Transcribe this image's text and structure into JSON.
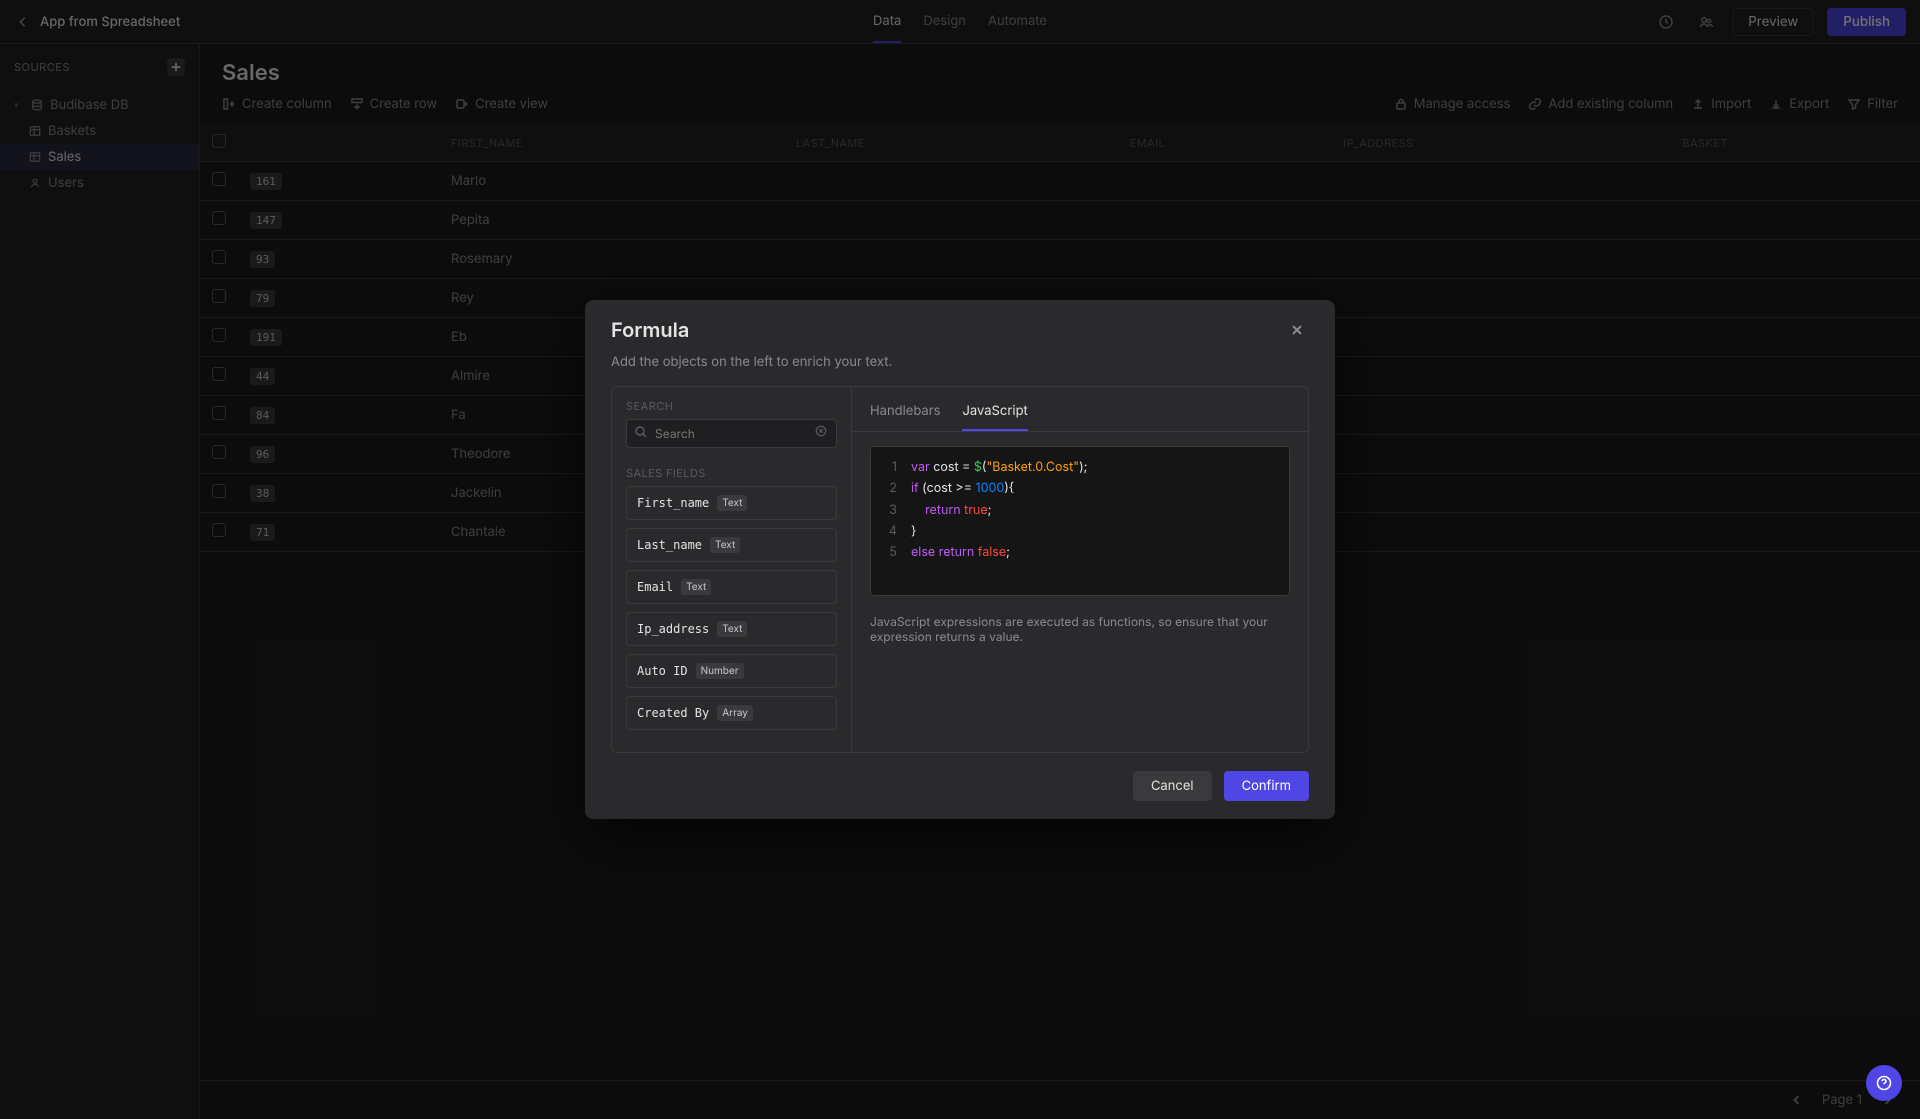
{
  "header": {
    "app_name": "App from Spreadsheet",
    "tabs": {
      "data": "Data",
      "design": "Design",
      "automate": "Automate"
    },
    "preview_label": "Preview",
    "publish_label": "Publish"
  },
  "sidebar": {
    "sources_label": "Sources",
    "db_node": "Budibase DB",
    "children": [
      {
        "label": "Baskets"
      },
      {
        "label": "Sales"
      },
      {
        "label": "Users"
      }
    ]
  },
  "table": {
    "title": "Sales",
    "toolbar": {
      "create_column": "Create column",
      "create_row": "Create row",
      "create_view": "Create view",
      "manage": "Manage access",
      "add_existing": "Add existing column",
      "import": "Import",
      "export": "Export",
      "filter": "Filter"
    },
    "columns": [
      "",
      "",
      "FIRST_NAME",
      "LAST_NAME",
      "EMAIL",
      "IP_ADDRESS",
      "BASKET"
    ],
    "rows": [
      {
        "id": "161",
        "first": "Marlo"
      },
      {
        "id": "147",
        "first": "Pepita"
      },
      {
        "id": "93",
        "first": "Rosemary"
      },
      {
        "id": "79",
        "first": "Rey"
      },
      {
        "id": "191",
        "first": "Eb"
      },
      {
        "id": "44",
        "first": "Almire"
      },
      {
        "id": "84",
        "first": "Fa"
      },
      {
        "id": "96",
        "first": "Theodore"
      },
      {
        "id": "38",
        "first": "Jackelin"
      },
      {
        "id": "71",
        "first": "Chantale"
      }
    ],
    "pager": {
      "label": "Page 1"
    }
  },
  "modal": {
    "title": "Formula",
    "subtitle": "Add the objects on the left to enrich your text.",
    "search_label": "SEARCH",
    "search_placeholder": "Search",
    "fields_group": "SALES FIELDS",
    "fields": [
      {
        "name": "First_name",
        "type": "Text"
      },
      {
        "name": "Last_name",
        "type": "Text"
      },
      {
        "name": "Email",
        "type": "Text"
      },
      {
        "name": "Ip_address",
        "type": "Text"
      },
      {
        "name": "Auto ID",
        "type": "Number"
      },
      {
        "name": "Created By",
        "type": "Array"
      }
    ],
    "lang_tabs": {
      "handlebars": "Handlebars",
      "javascript": "JavaScript"
    },
    "code": {
      "l1": "var cost = $(\"Basket.0.Cost\");",
      "l2": "if (cost >= 1000){",
      "l3": "    return true;",
      "l4": "}",
      "l5": "else return false;"
    },
    "js_hint": "JavaScript expressions are executed as functions, so ensure that your expression returns a value.",
    "cancel": "Cancel",
    "confirm": "Confirm"
  }
}
